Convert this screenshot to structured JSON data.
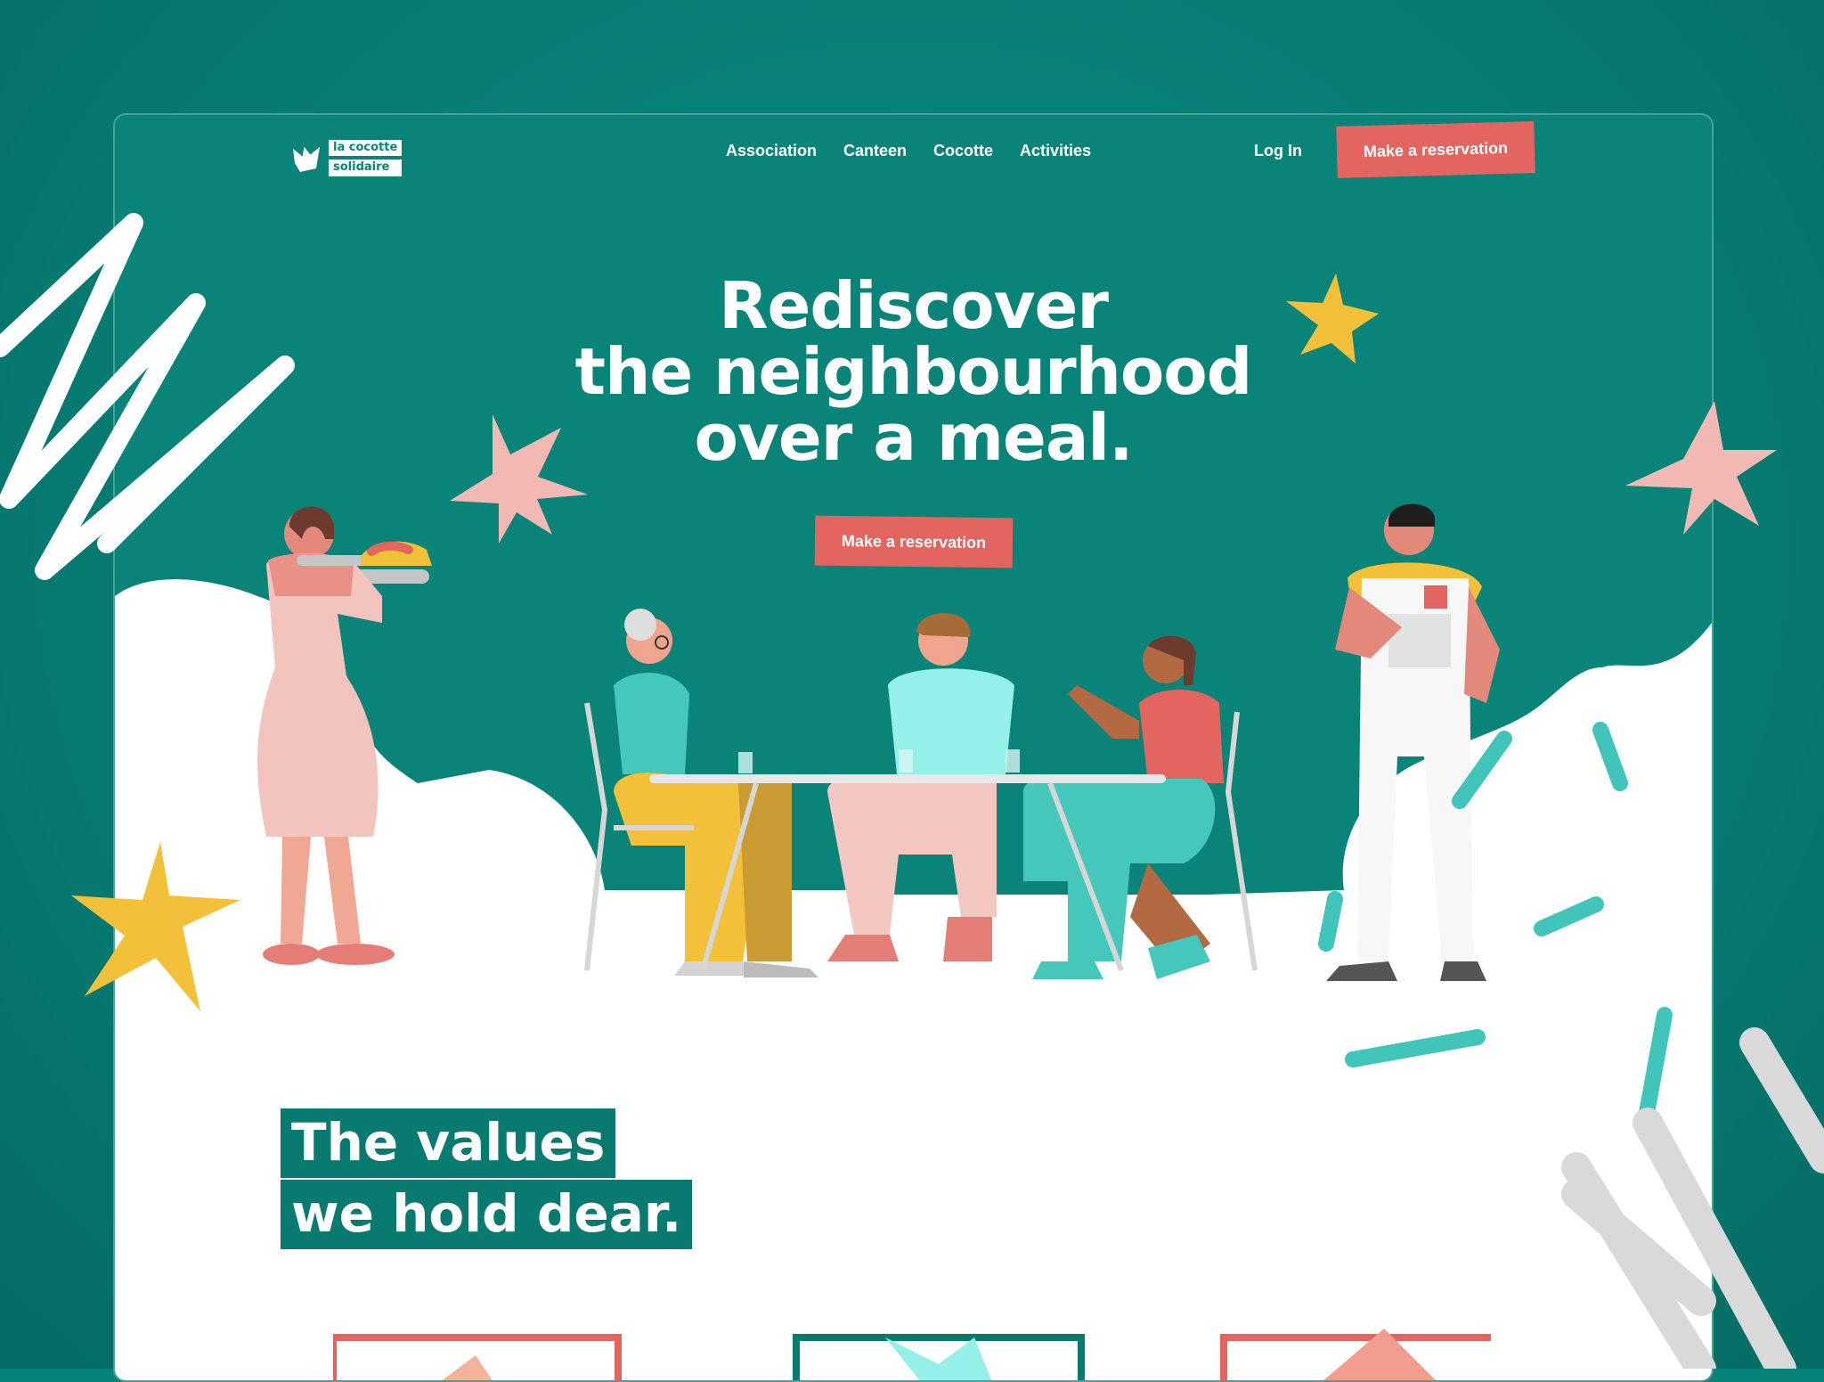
{
  "logo": {
    "line1": "la cocotte",
    "line2": "solidaire"
  },
  "nav": {
    "items": [
      {
        "label": "Association"
      },
      {
        "label": "Canteen"
      },
      {
        "label": "Cocotte"
      },
      {
        "label": "Activities"
      }
    ],
    "login_label": "Log In",
    "reserve_label": "Make a reservation"
  },
  "hero": {
    "line1": "Rediscover",
    "line2": "the neighbourhood",
    "line3": "over a meal.",
    "cta_label": "Make a reservation"
  },
  "values": {
    "line1": "The values",
    "line2": "we hold dear."
  },
  "colors": {
    "brand_teal": "#0a8479",
    "cta_coral": "#e2655f",
    "star_yellow": "#f3c03a",
    "star_pink": "#f2b8b3"
  }
}
